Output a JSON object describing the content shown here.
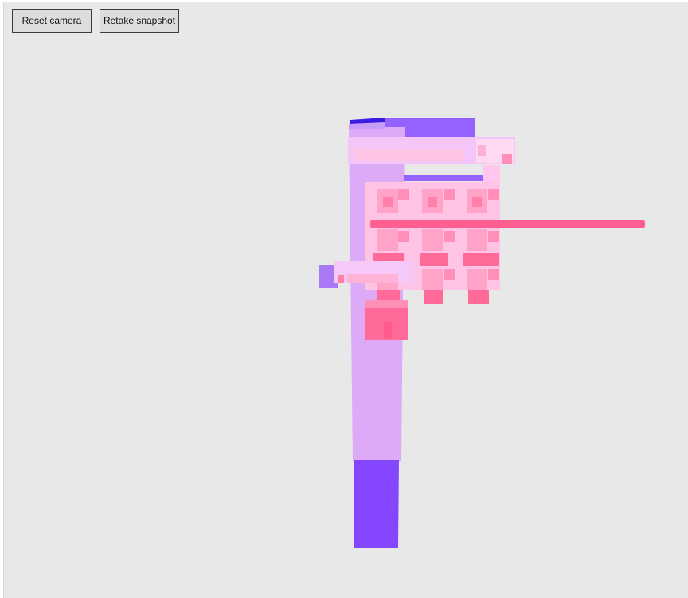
{
  "toolbar": {
    "reset_camera_label": "Reset camera",
    "retake_snapshot_label": "Retake snapshot"
  },
  "colors": {
    "background": "#e8e8e8",
    "pole_light": "#dcaaf7",
    "pole_dark": "#8447ff",
    "top_slab": "#9362ff",
    "pink_face": "#ffa3c8",
    "pink_light": "#ffc3e6",
    "pink_deep": "#ff6a98",
    "rod": "#ff5f90",
    "side_block": "#a978f4"
  }
}
